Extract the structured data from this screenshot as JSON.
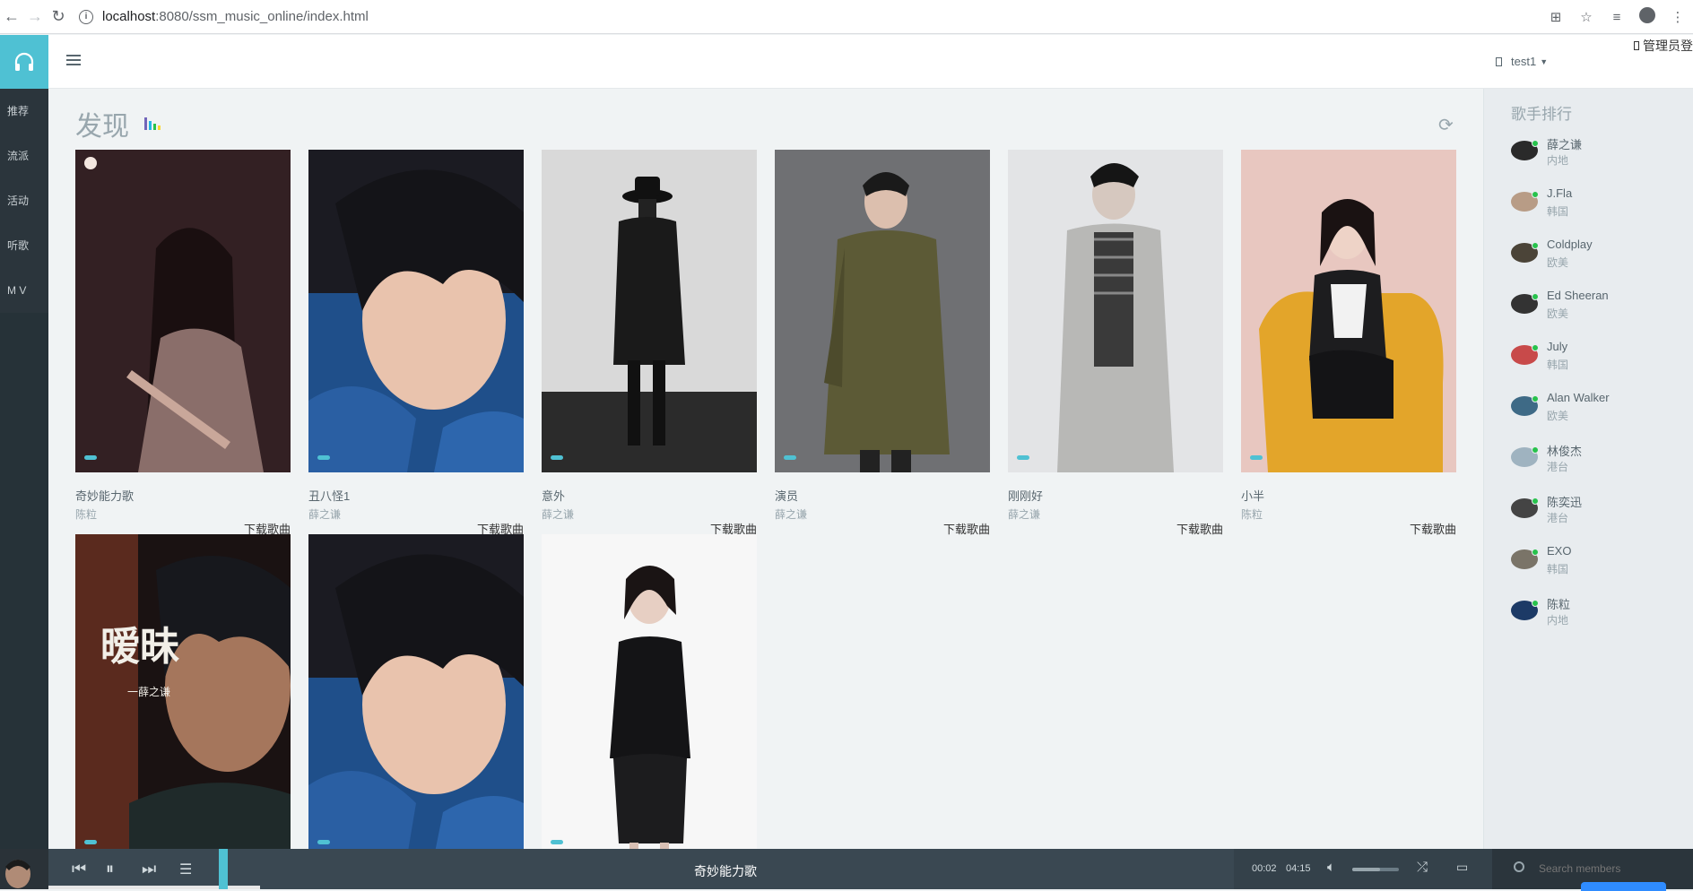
{
  "browser": {
    "url_host": "localhost",
    "url_path": ":8080/ssm_music_online/index.html"
  },
  "header": {
    "user_name": "test1",
    "admin_login": "管理员登"
  },
  "sidebar": {
    "items": [
      {
        "label": "推荐"
      },
      {
        "label": "流派"
      },
      {
        "label": "活动"
      },
      {
        "label": "听歌"
      },
      {
        "label": "M V"
      }
    ]
  },
  "main": {
    "title": "发现",
    "download_label": "下载歌曲",
    "songs": [
      {
        "title": "奇妙能力歌",
        "artist": "陈粒"
      },
      {
        "title": "丑八怪1",
        "artist": "薛之谦"
      },
      {
        "title": "意外",
        "artist": "薛之谦"
      },
      {
        "title": "演员",
        "artist": "薛之谦"
      },
      {
        "title": "刚刚好",
        "artist": "薛之谦"
      },
      {
        "title": "小半",
        "artist": "陈粒"
      }
    ],
    "cover_text": "暧昧",
    "cover_sub": "一薛之谦"
  },
  "right_panel": {
    "title": "歌手排行",
    "artists": [
      {
        "name": "薛之谦",
        "region": "内地"
      },
      {
        "name": "J.Fla",
        "region": "韩国"
      },
      {
        "name": "Coldplay",
        "region": "欧美"
      },
      {
        "name": "Ed Sheeran",
        "region": "欧美"
      },
      {
        "name": "July",
        "region": "韩国"
      },
      {
        "name": "Alan Walker",
        "region": "欧美"
      },
      {
        "name": "林俊杰",
        "region": "港台"
      },
      {
        "name": "陈奕迅",
        "region": "港台"
      },
      {
        "name": "EXO",
        "region": "韩国"
      },
      {
        "name": "陈粒",
        "region": "内地"
      }
    ]
  },
  "player": {
    "now_playing": "奇妙能力歌",
    "current_time": "00:02",
    "duration": "04:15",
    "volume": 0.6,
    "search_placeholder": "Search members"
  },
  "colors": {
    "accent": "#4fc1d3",
    "sidebar": "#263238",
    "player": "#3a4852",
    "online": "#27c24c"
  }
}
